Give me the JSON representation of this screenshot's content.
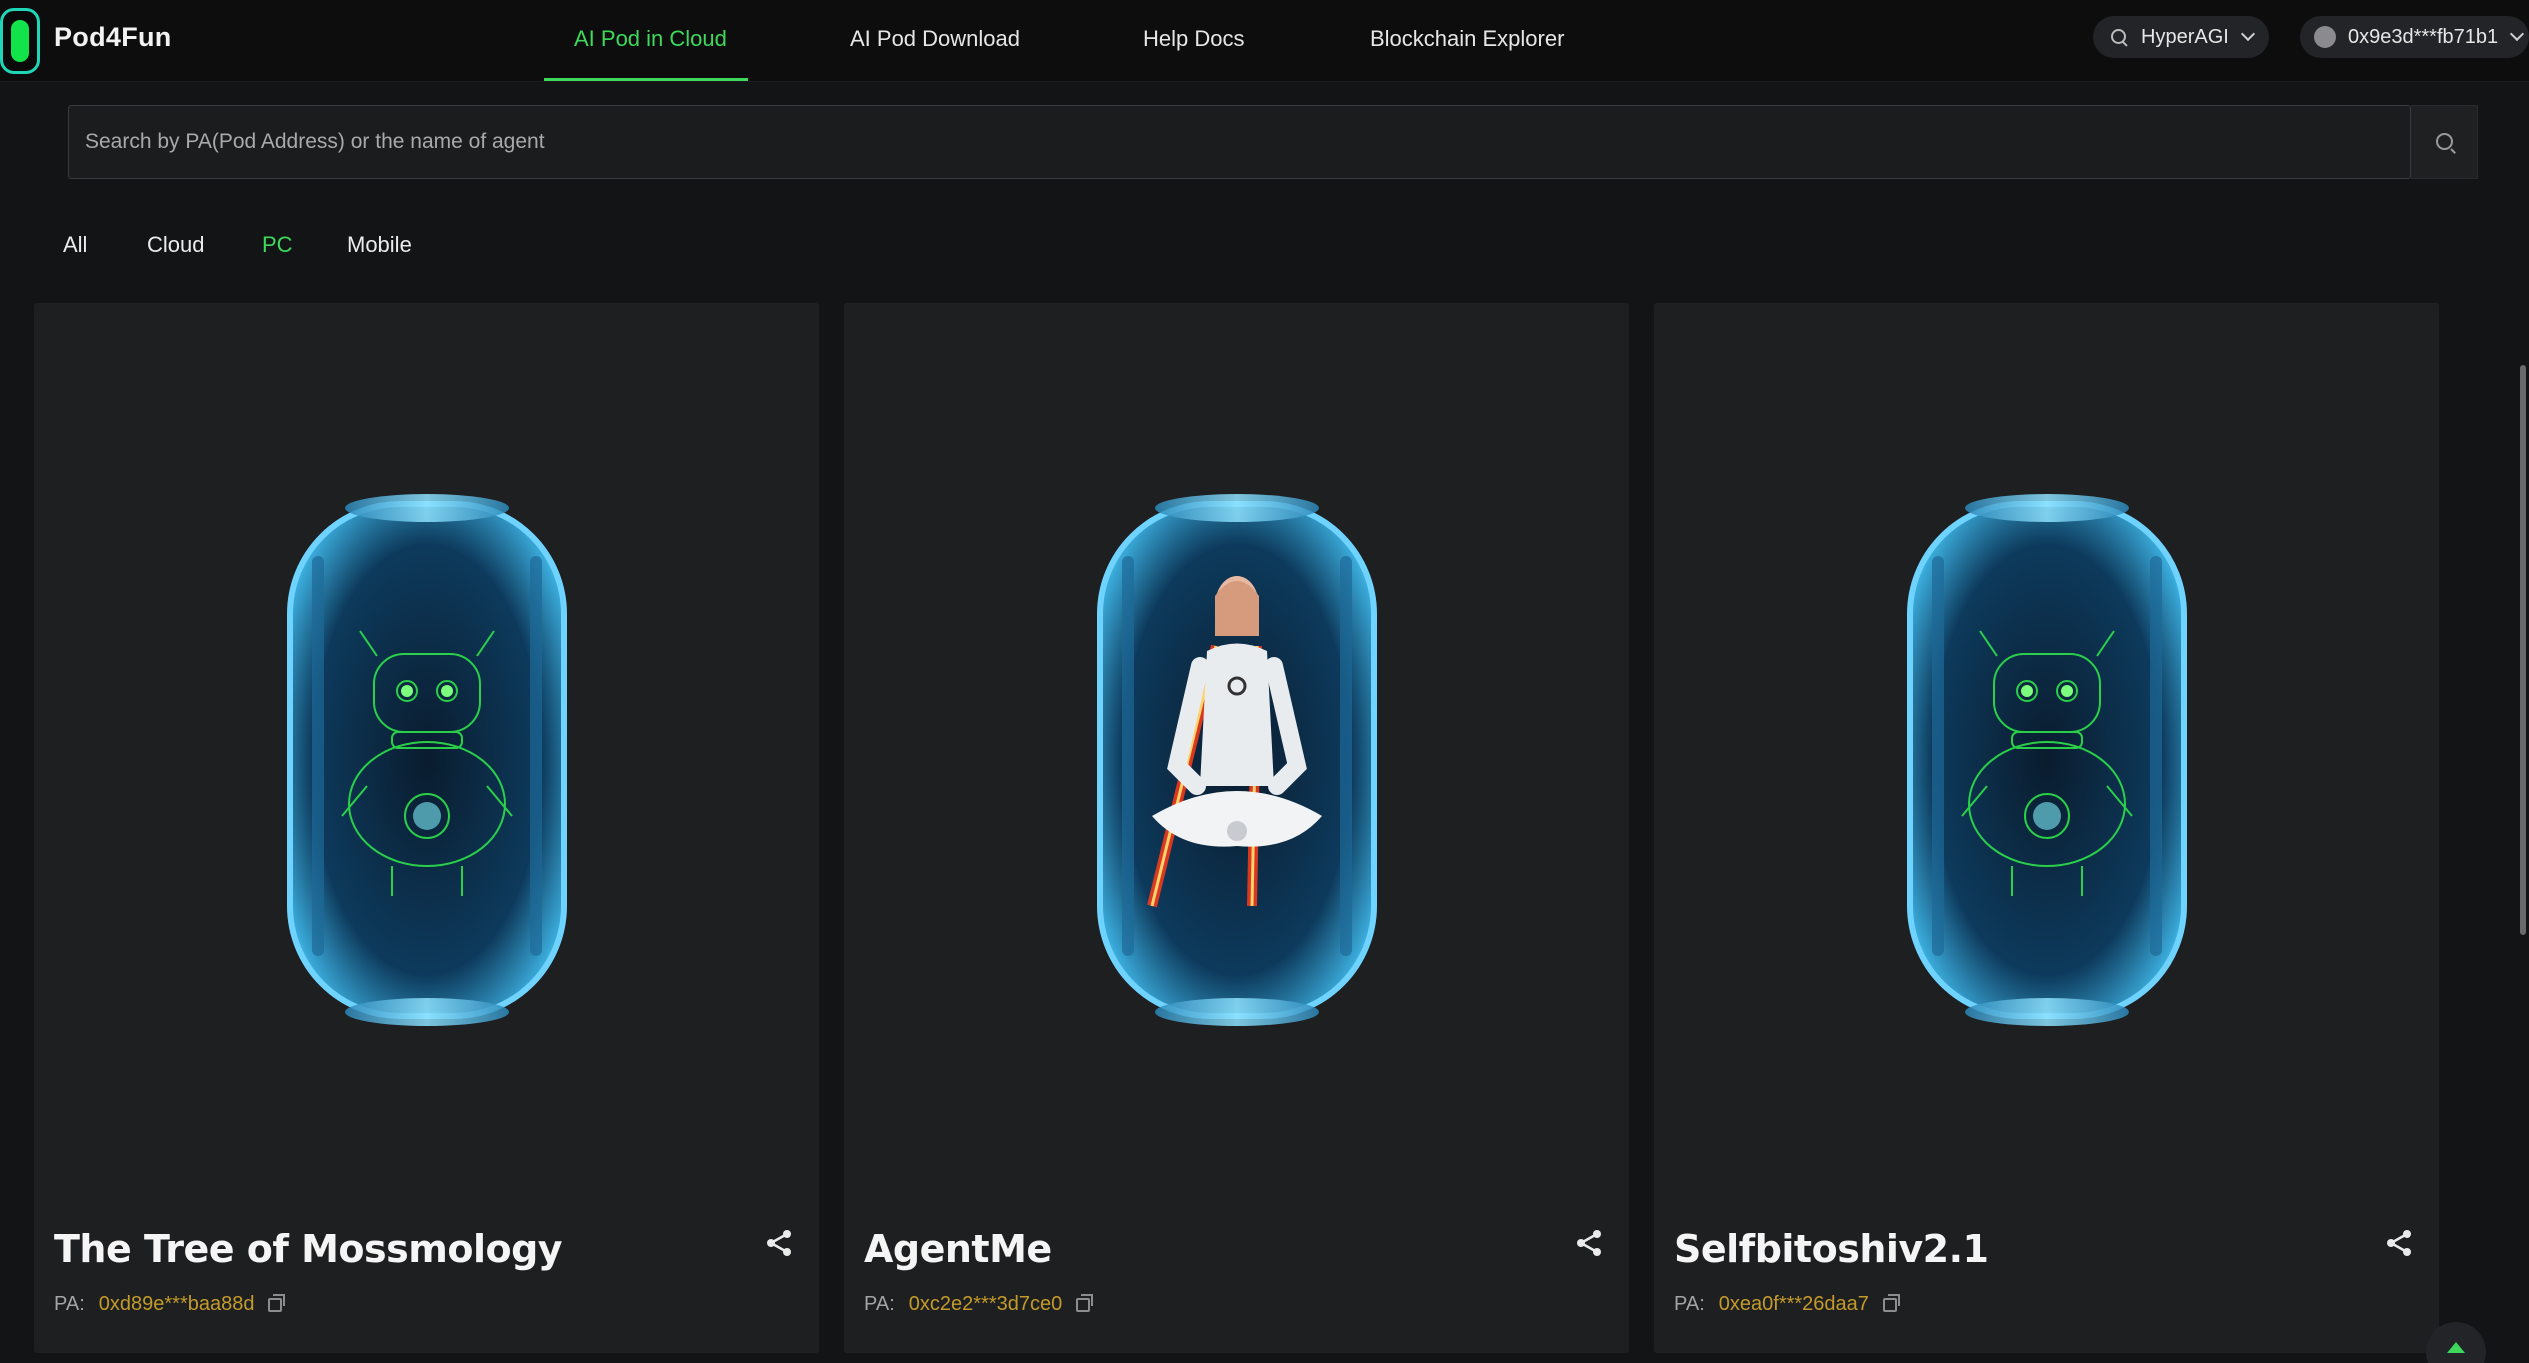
{
  "brand": {
    "name": "Pod4Fun"
  },
  "nav": {
    "items": [
      {
        "label": "AI Pod in Cloud",
        "active": true
      },
      {
        "label": "AI Pod Download",
        "active": false
      },
      {
        "label": "Help Docs",
        "active": false
      },
      {
        "label": "Blockchain Explorer",
        "active": false
      }
    ]
  },
  "network": {
    "label": "HyperAGI",
    "icon": "search-network-icon"
  },
  "wallet": {
    "address": "0x9e3d***fb71b1"
  },
  "search": {
    "placeholder": "Search by PA(Pod Address) or the name of agent",
    "value": ""
  },
  "filters": [
    {
      "label": "All",
      "active": false
    },
    {
      "label": "Cloud",
      "active": false
    },
    {
      "label": "PC",
      "active": true
    },
    {
      "label": "Mobile",
      "active": false
    }
  ],
  "cards": [
    {
      "title": "The Tree of Mossmology",
      "pa_label": "PA:",
      "pa": "0xd89e***baa88d",
      "image": "robot-pod"
    },
    {
      "title": "AgentMe",
      "pa_label": "PA:",
      "pa": "0xc2e2***3d7ce0",
      "image": "meditating-agent-pod"
    },
    {
      "title": "Selfbitoshiv2.1",
      "pa_label": "PA:",
      "pa": "0xea0f***26daa7",
      "image": "robot-pod"
    }
  ],
  "colors": {
    "accent": "#3ed95c",
    "address": "#c39b2a",
    "card_bg": "#1e1f21",
    "page_bg": "#131415"
  }
}
